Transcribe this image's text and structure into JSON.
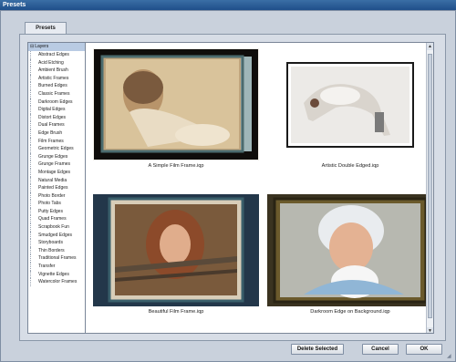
{
  "window": {
    "title": "Presets"
  },
  "tabs": [
    {
      "label": "Presets"
    }
  ],
  "tree": {
    "root": "Layers",
    "items": [
      "Abstract Edges",
      "Acid Etching",
      "Ambient Brush",
      "Artistic Frames",
      "Burned Edges",
      "Classic Frames",
      "Darkroom Edges",
      "Digital Edges",
      "Distort Edges",
      "Dual Frames",
      "Edge Brush",
      "Film Frames",
      "Geometric Edges",
      "Grunge Edges",
      "Grunge Frames",
      "Montage Edges",
      "Natural Media",
      "Painted Edges",
      "Photo Border",
      "Photo Tabs",
      "Putty Edges",
      "Quad Frames",
      "Scrapbook Fun",
      "Smudged Edges",
      "Storyboards",
      "Thin Borders",
      "Traditional Frames",
      "Transfer",
      "Vignette Edges",
      "Watercolor Frames"
    ]
  },
  "presets": [
    {
      "caption": "A Simple Film Frame.iqp"
    },
    {
      "caption": "Artistic Double Edged.iqp"
    },
    {
      "caption": "Beautiful Film Frame.iqp"
    },
    {
      "caption": "Darkroom Edge on Background.iqp"
    }
  ],
  "buttons": {
    "delete_selected": "Delete Selected",
    "cancel": "Cancel",
    "ok": "OK"
  }
}
